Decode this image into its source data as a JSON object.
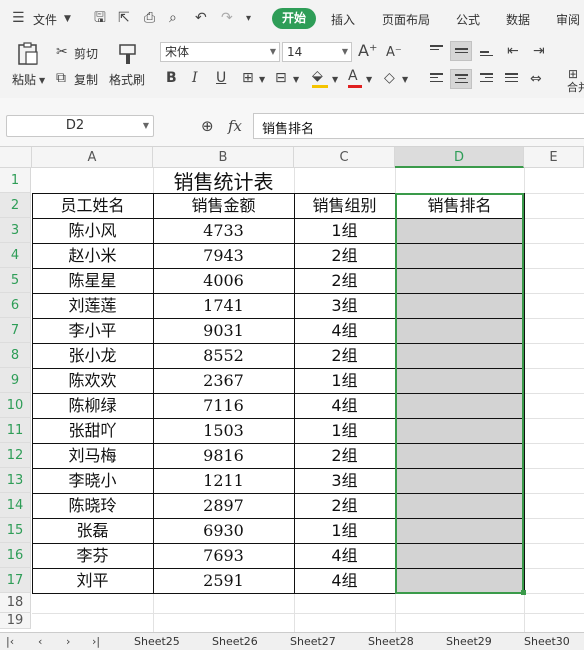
{
  "menu": {
    "file": "文件",
    "tabs": [
      "开始",
      "插入",
      "页面布局",
      "公式",
      "数据",
      "审阅"
    ]
  },
  "ribbon": {
    "paste": "粘贴",
    "cut": "剪切",
    "copy": "复制",
    "format_painter": "格式刷",
    "font_name": "宋体",
    "font_size": "14",
    "merge": "合并"
  },
  "formula_bar": {
    "cell_ref": "D2",
    "fx": "fx",
    "content": "销售排名"
  },
  "sheet": {
    "columns": [
      "A",
      "B",
      "C",
      "D",
      "E"
    ],
    "rows": [
      "1",
      "2",
      "3",
      "4",
      "5",
      "6",
      "7",
      "8",
      "9",
      "10",
      "11",
      "12",
      "13",
      "14",
      "15",
      "16",
      "17",
      "18",
      "19"
    ],
    "title": "销售统计表",
    "headers": [
      "员工姓名",
      "销售金额",
      "销售组别",
      "销售排名"
    ],
    "data": [
      {
        "name": "陈小风",
        "amount": "4733",
        "group": "1组"
      },
      {
        "name": "赵小米",
        "amount": "7943",
        "group": "2组"
      },
      {
        "name": "陈星星",
        "amount": "4006",
        "group": "2组"
      },
      {
        "name": "刘莲莲",
        "amount": "1741",
        "group": "3组"
      },
      {
        "name": "李小平",
        "amount": "9031",
        "group": "4组"
      },
      {
        "name": "张小龙",
        "amount": "8552",
        "group": "2组"
      },
      {
        "name": "陈欢欢",
        "amount": "2367",
        "group": "1组"
      },
      {
        "name": "陈柳绿",
        "amount": "7116",
        "group": "4组"
      },
      {
        "name": "张甜吖",
        "amount": "1503",
        "group": "1组"
      },
      {
        "name": "刘马梅",
        "amount": "9816",
        "group": "2组"
      },
      {
        "name": "李晓小",
        "amount": "1211",
        "group": "3组"
      },
      {
        "name": "陈晓玲",
        "amount": "2897",
        "group": "2组"
      },
      {
        "name": "张磊",
        "amount": "6930",
        "group": "1组"
      },
      {
        "name": "李芬",
        "amount": "7693",
        "group": "4组"
      },
      {
        "name": "刘平",
        "amount": "2591",
        "group": "4组"
      }
    ]
  },
  "sheet_tabs": [
    "Sheet25",
    "Sheet26",
    "Sheet27",
    "Sheet28",
    "Sheet29",
    "Sheet30"
  ],
  "colors": {
    "accent": "#2e9d57",
    "selection": "#d3d3d3",
    "selection_border": "#3a9a4a"
  }
}
